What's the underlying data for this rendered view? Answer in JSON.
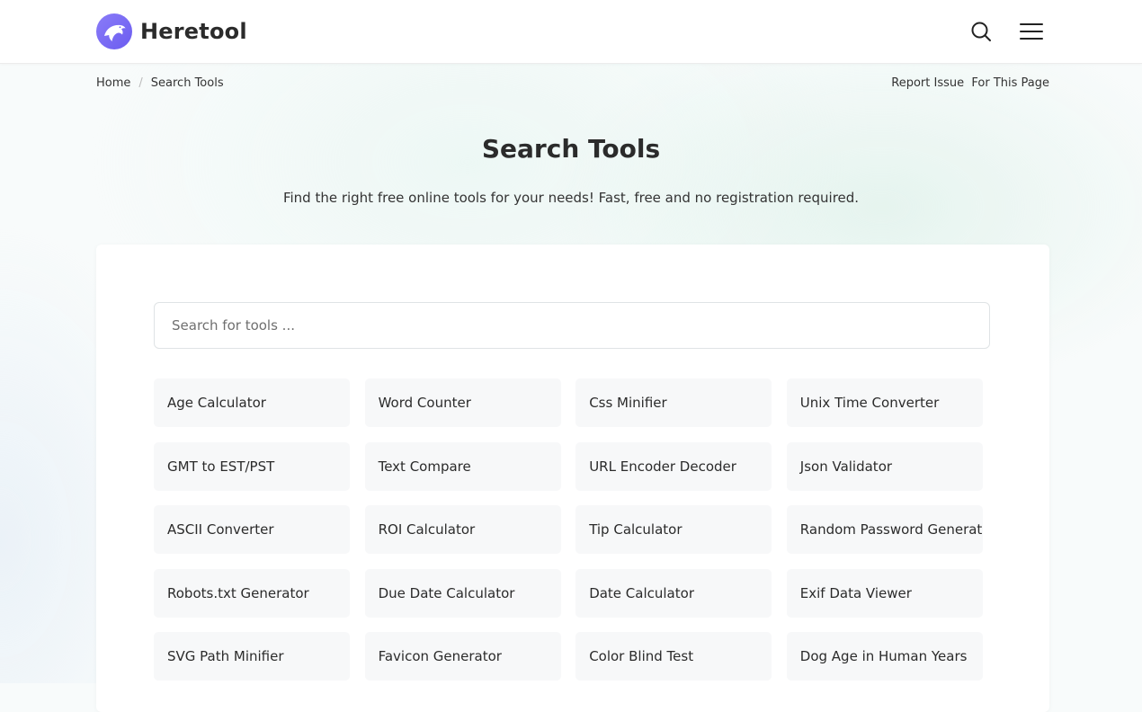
{
  "header": {
    "logo_text": "Heretool",
    "logo_icon": "dolphin-icon",
    "search_icon": "search-icon",
    "menu_icon": "hamburger-menu-icon",
    "brand_color": "#7b6cf6"
  },
  "breadcrumb": {
    "items": [
      "Home",
      "Search Tools"
    ],
    "separator": "/"
  },
  "report_link": "Report Issue  For This Page",
  "page": {
    "title": "Search Tools",
    "subtitle": "Find the right free online tools for your needs! Fast, free and no registration required."
  },
  "search": {
    "placeholder": "Search for tools ...",
    "value": ""
  },
  "tools": [
    "Age Calculator",
    "Word Counter",
    "Css Minifier",
    "Unix Time Converter",
    "GMT to EST/PST",
    "Text Compare",
    "URL Encoder Decoder",
    "Json Validator",
    "ASCII Converter",
    "ROI Calculator",
    "Tip Calculator",
    "Random Password Generator",
    "Robots.txt Generator",
    "Due Date Calculator",
    "Date Calculator",
    "Exif Data Viewer",
    "SVG Path Minifier",
    "Favicon Generator",
    "Color Blind Test",
    "Dog Age in Human Years"
  ]
}
